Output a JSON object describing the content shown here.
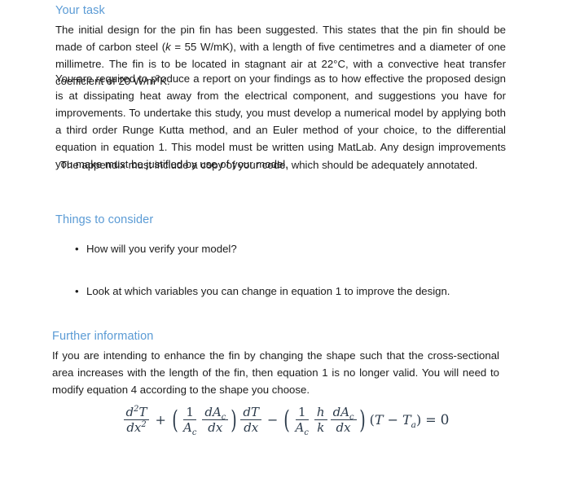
{
  "document": {
    "sections": [
      {
        "heading": "Your task",
        "paragraphs": [
          "The initial design for the pin fin has been suggested. This states that the pin fin should be made of carbon steel (k = 55 W/mK), with a length of five centimetres and a diameter of one millimetre. The fin is to be located in stagnant air at 22°C, with a convective heat transfer coefficient of 20 W/m2K.",
          "You are required to produce a report on your findings as to how effective the proposed design is at dissipating heat away from the electrical component, and suggestions you have for improvements. To undertake this study, you must develop a numerical model by applying both a third order Runge Kutta method, and an Euler method of your choice, to the differential equation in equation 1. This model must be written using MatLab. Any design improvements you make must be justified by use of your model.",
          "The appendix must include a copy of your code, which should be adequately annotated."
        ]
      },
      {
        "heading": "Things to consider",
        "bullets": [
          "How will you verify your model?",
          "Look at which variables you can change in equation 1 to improve the design."
        ]
      },
      {
        "heading": "Further information",
        "paragraphs": [
          "If you are intending to enhance the fin by changing the shape such that the cross-sectional area increases with the length of the fin, then equation 1 is no longer valid. You will need to modify equation 4 according to the shape you choose."
        ]
      }
    ]
  },
  "paragraph_1_parts": {
    "before_k": "The initial design for the pin fin has been suggested. This states that the pin fin should be made of carbon steel (",
    "k_symbol": "k",
    "after_k": " = 55 W/mK), with a length of five centimetres and a diameter of one millimetre. The fin is to be located in stagnant air at 22°C, with a convective heat transfer coefficient of 20 W/m",
    "superscript": "2",
    "tail": "K."
  },
  "equation": {
    "label": "second-order fin differential equation",
    "plain_text": "d2T/dx2 + (1/Ac · dAc/dx) dT/dx − (1/Ac · h/k · dAc/dx)(T − Ta) = 0",
    "tokens": {
      "d2T": "d",
      "d2T_sup": "2",
      "d2T_var": "T",
      "dx2": "dx",
      "dx2_sup": "2",
      "plus": "+",
      "one": "1",
      "A": "A",
      "c": "c",
      "dA": "dA",
      "dx": "dx",
      "dT": "dT",
      "minus": "−",
      "h": "h",
      "k": "k",
      "open_paren": "(",
      "close_paren": ")",
      "T": "T",
      "minus2": "−",
      "Ta": "T",
      "a": "a",
      "equals": "=",
      "zero": "0"
    }
  },
  "style": {
    "heading_color": "#5b9bd5",
    "body_color": "#1c1c1c",
    "math_color": "#2b3a4a",
    "background": "#ffffff"
  }
}
